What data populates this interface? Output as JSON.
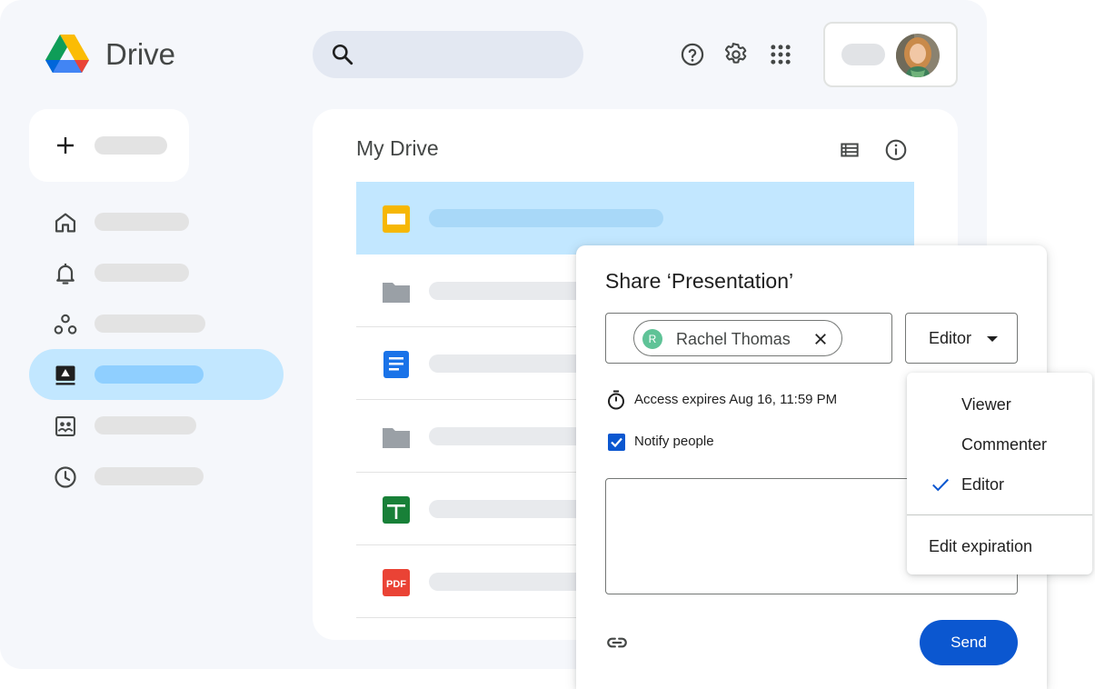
{
  "app": {
    "brand": "Drive",
    "colors": {
      "accent": "#0b57d0",
      "selected": "#c2e7ff",
      "background": "#f5f7fb"
    }
  },
  "header": {
    "search_icon": "search-icon",
    "icons": [
      "help-icon",
      "settings-icon",
      "apps-grid-icon"
    ]
  },
  "sidebar": {
    "new_icon": "plus-icon",
    "items": [
      {
        "icon": "home-icon",
        "active": false
      },
      {
        "icon": "notifications-icon",
        "active": false
      },
      {
        "icon": "shared-icon",
        "active": false
      },
      {
        "icon": "my-drive-icon",
        "active": true
      },
      {
        "icon": "shared-drives-icon",
        "active": false
      },
      {
        "icon": "recent-icon",
        "active": false
      }
    ]
  },
  "main": {
    "title": "My Drive",
    "view_icons": [
      "list-view-icon",
      "info-icon"
    ],
    "files": [
      {
        "type": "slides-icon",
        "selected": true
      },
      {
        "type": "folder-icon",
        "selected": false
      },
      {
        "type": "docs-icon",
        "selected": false
      },
      {
        "type": "folder-icon",
        "selected": false
      },
      {
        "type": "sheets-icon",
        "selected": false
      },
      {
        "type": "pdf-icon",
        "label": "PDF",
        "selected": false
      }
    ]
  },
  "share_dialog": {
    "title": "Share ‘Presentation’",
    "person": {
      "initial": "R",
      "name": "Rachel Thomas"
    },
    "role": "Editor",
    "expiry": "Access expires Aug 16, 11:59 PM",
    "notify_label": "Notify people",
    "notify_checked": true,
    "send_label": "Send",
    "link_icon": "link-icon"
  },
  "role_menu": {
    "items": [
      {
        "label": "Viewer",
        "checked": false
      },
      {
        "label": "Commenter",
        "checked": false
      },
      {
        "label": "Editor",
        "checked": true
      }
    ],
    "expiration_label": "Edit expiration"
  }
}
